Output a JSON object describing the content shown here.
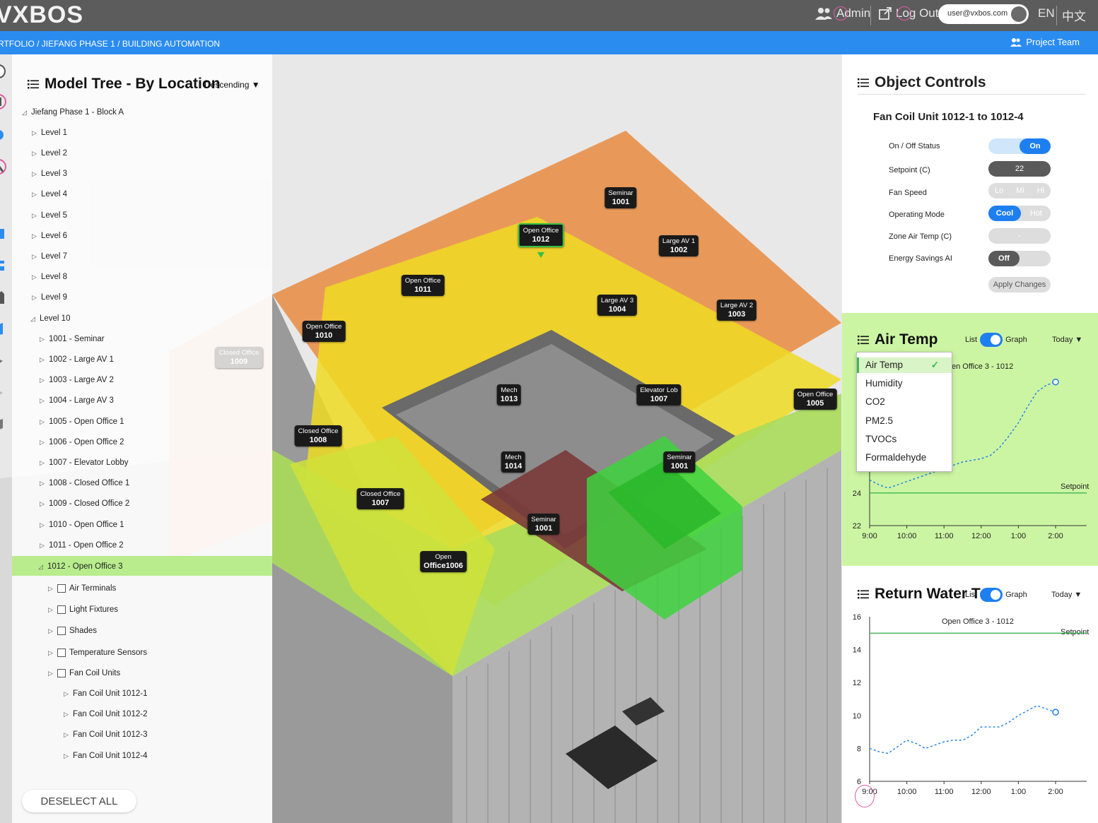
{
  "header": {
    "logo": "VXBOS",
    "admin_label": "Admin",
    "logout_label": "Log Out",
    "user_email": "user@vxbos.com",
    "lang_en": "EN",
    "lang_zh": "中文"
  },
  "breadcrumb": {
    "path": "RTFOLIO  /  JIEFANG PHASE 1  /  BUILDING AUTOMATION",
    "project_team": "Project Team"
  },
  "tree": {
    "title": "Model Tree - By Location",
    "sort": "Descending ▼",
    "root": "Jiefang Phase 1 - Block A",
    "levels": [
      "Level 1",
      "Level 2",
      "Level 3",
      "Level 4",
      "Level 5",
      "Level 6",
      "Level 7",
      "Level 8",
      "Level 9"
    ],
    "level10": "Level 10",
    "rooms": [
      "1001 - Seminar",
      "1002 - Large AV 1",
      "1003 - Large AV 2",
      "1004 - Large AV 3",
      "1005 - Open Office 1",
      "1006 - Open Office 2",
      "1007 - Elevator Lobby",
      "1008 - Closed Office 1",
      "1009 - Closed Office 2",
      "1010 - Open Office 1",
      "1011 - Open Office 2"
    ],
    "selected_room": "1012 - Open Office 3",
    "categories": [
      "Air Terminals",
      "Light Fixtures",
      "Shades",
      "Temperature Sensors",
      "Fan Coil Units"
    ],
    "fan_coils": [
      "Fan Coil Unit 1012-1",
      "Fan Coil Unit 1012-2",
      "Fan Coil Unit 1012-3",
      "Fan Coil Unit 1012-4"
    ],
    "deselect_label": "DESELECT ALL"
  },
  "rooms3d": [
    {
      "name": "Seminar",
      "num": "1001"
    },
    {
      "name": "Open Office",
      "num": "1012"
    },
    {
      "name": "Large AV 1",
      "num": "1002"
    },
    {
      "name": "Open Office",
      "num": "1011"
    },
    {
      "name": "Large AV 3",
      "num": "1004"
    },
    {
      "name": "Large AV 2",
      "num": "1003"
    },
    {
      "name": "Open Office",
      "num": "1010"
    },
    {
      "name": "Closed Office",
      "num": "1009"
    },
    {
      "name": "Mech",
      "num": "1013"
    },
    {
      "name": "Elevator Lob",
      "num": "1007"
    },
    {
      "name": "Open Office",
      "num": "1005"
    },
    {
      "name": "Closed Office",
      "num": "1008"
    },
    {
      "name": "Mech",
      "num": "1014"
    },
    {
      "name": "Seminar",
      "num": "1001"
    },
    {
      "name": "Closed Office",
      "num": "1007"
    },
    {
      "name": "Seminar",
      "num": "1001"
    },
    {
      "name": "Open",
      "num": "Office1006"
    }
  ],
  "object_controls": {
    "title": "Object Controls",
    "unit": "Fan Coil Unit 1012-1 to 1012-4",
    "labels": {
      "on_off": "On / Off Status",
      "setpoint": "Setpoint (C)",
      "fan_speed": "Fan Speed",
      "mode": "Operating Mode",
      "zone_temp": "Zone Air Temp (C)",
      "energy_ai": "Energy Savings AI"
    },
    "values": {
      "on": "On",
      "setpoint": "22",
      "fan_lo": "Lo",
      "fan_mi": "Mi",
      "fan_hi": "Hi",
      "mode_cool": "Cool",
      "mode_hot": "Hot",
      "zone_temp": "-",
      "energy_ai": "Off",
      "apply": "Apply Changes"
    }
  },
  "air_temp": {
    "title": "Air Temp",
    "list_label": "List",
    "graph_label": "Graph",
    "period": "Today  ▼",
    "dropdown": [
      "Air Temp",
      "Humidity",
      "CO2",
      "PM2.5",
      "TVOCs",
      "Formaldehyde"
    ],
    "dropdown_check": "✓",
    "room_label": "en Office 3 - 1012",
    "setpoint_label": "Setpoint"
  },
  "return_water": {
    "title": "Return Water T",
    "list_label": "List",
    "graph_label": "Graph",
    "period": "Today  ▼",
    "room_label": "Open Office 3 - 1012",
    "setpoint_label": "Setpoint"
  },
  "chart_data": [
    {
      "type": "line",
      "x": [
        "9:00",
        "9:15",
        "9:30",
        "9:45",
        "10:00",
        "10:15",
        "10:30",
        "10:45",
        "11:00",
        "11:15",
        "11:30",
        "11:45",
        "12:00",
        "12:15",
        "12:30",
        "12:45",
        "1:00",
        "1:15",
        "1:30",
        "1:45",
        "2:00"
      ],
      "series": [
        {
          "values": [
            24.8,
            24.5,
            24.3,
            24.5,
            24.7,
            24.9,
            25.1,
            25.3,
            25.5,
            25.7,
            25.9,
            26.0,
            26.1,
            26.3,
            26.8,
            27.5,
            28.3,
            29.3,
            30.2,
            30.6,
            30.8
          ]
        }
      ],
      "x_tick_labels": [
        "9:00",
        "10:00",
        "11:00",
        "12:00",
        "1:00",
        "2:00"
      ],
      "y_tick_labels": [
        "22",
        "24"
      ],
      "setpoint": 24.0,
      "ylim": [
        22,
        32
      ]
    },
    {
      "type": "line",
      "x": [
        "9:00",
        "9:15",
        "9:30",
        "9:45",
        "10:00",
        "10:15",
        "10:30",
        "10:45",
        "11:00",
        "11:15",
        "11:30",
        "11:45",
        "12:00",
        "12:15",
        "12:30",
        "12:45",
        "1:00",
        "1:15",
        "1:30",
        "1:45",
        "2:00"
      ],
      "series": [
        {
          "values": [
            8.0,
            7.8,
            7.7,
            8.1,
            8.5,
            8.3,
            8.0,
            8.2,
            8.4,
            8.5,
            8.5,
            8.8,
            9.3,
            9.3,
            9.3,
            9.6,
            10.0,
            10.3,
            10.6,
            10.4,
            10.2
          ]
        }
      ],
      "x_tick_labels": [
        "9:00",
        "10:00",
        "11:00",
        "12:00",
        "1:00",
        "2:00"
      ],
      "y_tick_labels": [
        "6",
        "8",
        "10",
        "12",
        "14",
        "16"
      ],
      "setpoint": 15.0,
      "ylim": [
        6,
        16
      ]
    }
  ],
  "colors": {
    "accent": "#2b8cf0",
    "selected_green": "#b8ec8c",
    "air_temp_bg": "#ccf5a3",
    "line": "#1e7ff0",
    "setpoint_line": "#3fb552"
  }
}
